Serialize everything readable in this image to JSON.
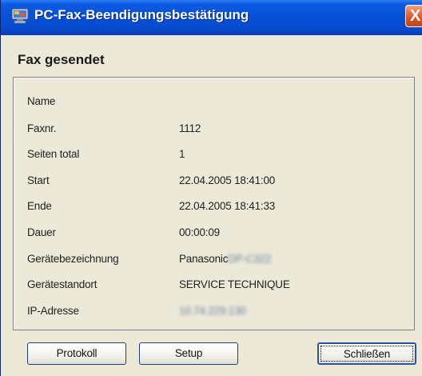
{
  "window": {
    "title": "PC-Fax-Beendigungsbestätigung",
    "close_label": "X"
  },
  "heading": "Fax gesendet",
  "details": [
    {
      "label": "Name",
      "value": ""
    },
    {
      "label": "Faxnr.",
      "value": "1112"
    },
    {
      "label": "Seiten total",
      "value": "1"
    },
    {
      "label": "Start",
      "value": "22.04.2005 18:41:00"
    },
    {
      "label": "Ende",
      "value": "22.04.2005 18:41:33"
    },
    {
      "label": "Dauer",
      "value": "00:00:09"
    },
    {
      "label": "Gerätebezeichnung",
      "value": "Panasonic",
      "value_obscured": "DP-C322"
    },
    {
      "label": "Gerätestandort",
      "value": "SERVICE TECHNIQUE"
    },
    {
      "label": "IP-Adresse",
      "value": "",
      "value_obscured": "10.74.229.130"
    }
  ],
  "buttons": {
    "protokoll": "Protokoll",
    "setup": "Setup",
    "schliessen": "Schließen"
  },
  "colors": {
    "titlebar": "#0752d9",
    "close": "#d9582d",
    "window_bg": "#ece9d8"
  },
  "icons": {
    "app": "fax-monitor-icon",
    "close": "close-icon"
  }
}
